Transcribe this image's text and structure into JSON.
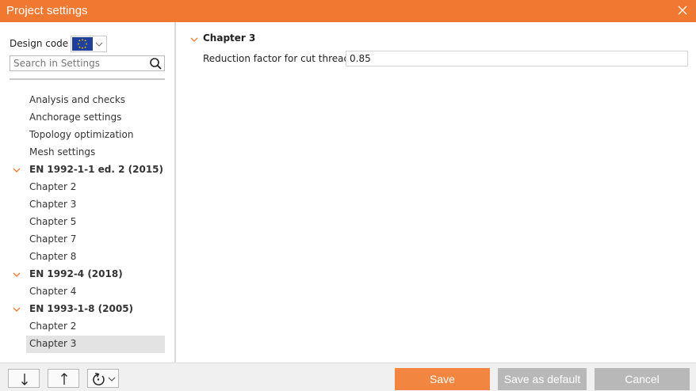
{
  "window": {
    "title": "Project settings",
    "close_icon": "close-icon",
    "accent_color": "#f07830"
  },
  "sidebar": {
    "design_code_label": "Design code",
    "design_code_flag": "eu-flag-icon",
    "search_placeholder": "Search in Settings",
    "items": [
      {
        "label": "Analysis and checks",
        "type": "item"
      },
      {
        "label": "Anchorage settings",
        "type": "item"
      },
      {
        "label": "Topology optimization",
        "type": "item"
      },
      {
        "label": "Mesh settings",
        "type": "item"
      },
      {
        "label": "EN 1992-1-1 ed. 2 (2015)",
        "type": "group"
      },
      {
        "label": "Chapter 2",
        "type": "item"
      },
      {
        "label": "Chapter 3",
        "type": "item"
      },
      {
        "label": "Chapter 5",
        "type": "item"
      },
      {
        "label": "Chapter 7",
        "type": "item"
      },
      {
        "label": "Chapter 8",
        "type": "item"
      },
      {
        "label": "EN 1992-4 (2018)",
        "type": "group"
      },
      {
        "label": "Chapter 4",
        "type": "item"
      },
      {
        "label": "EN 1993-1-8 (2005)",
        "type": "group"
      },
      {
        "label": "Chapter 2",
        "type": "item"
      },
      {
        "label": "Chapter 3",
        "type": "item",
        "selected": true
      }
    ]
  },
  "main": {
    "section_title": "Chapter 3",
    "properties": [
      {
        "label": "Reduction factor for cut threads",
        "value": "0.85"
      }
    ]
  },
  "footer": {
    "save_label": "Save",
    "save_default_label": "Save as default",
    "cancel_label": "Cancel",
    "save_color": "#f28640",
    "disabled_color": "#b8b8b8"
  }
}
